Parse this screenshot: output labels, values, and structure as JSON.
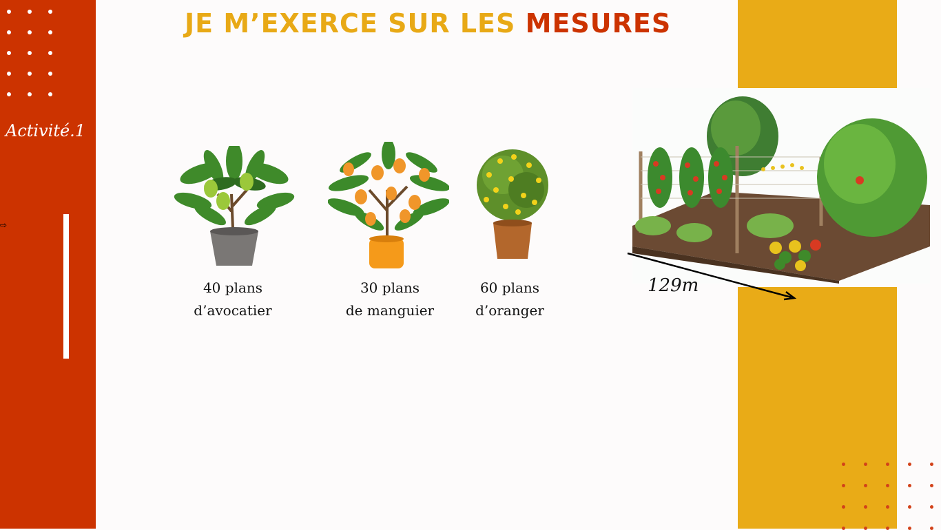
{
  "slide": {
    "title_part1": "Je m’exerce sur les ",
    "title_part2": "mesures",
    "activity": "Activité.1"
  },
  "plants": [
    {
      "line1": "40 plans",
      "line2": "d’avocatier",
      "icon": "avocado-tree-icon"
    },
    {
      "line1": "30 plans",
      "line2": "de manguier",
      "icon": "mango-tree-icon"
    },
    {
      "line1": "60 plans",
      "line2": "d’oranger",
      "icon": "orange-tree-icon"
    }
  ],
  "garden": {
    "measure": "129m",
    "icon": "vegetable-garden-illustration"
  },
  "colors": {
    "sidebar": "#cc3300",
    "accent_yellow": "#e9ab17",
    "title_yellow": "#e8a916",
    "title_red": "#cc3300"
  }
}
